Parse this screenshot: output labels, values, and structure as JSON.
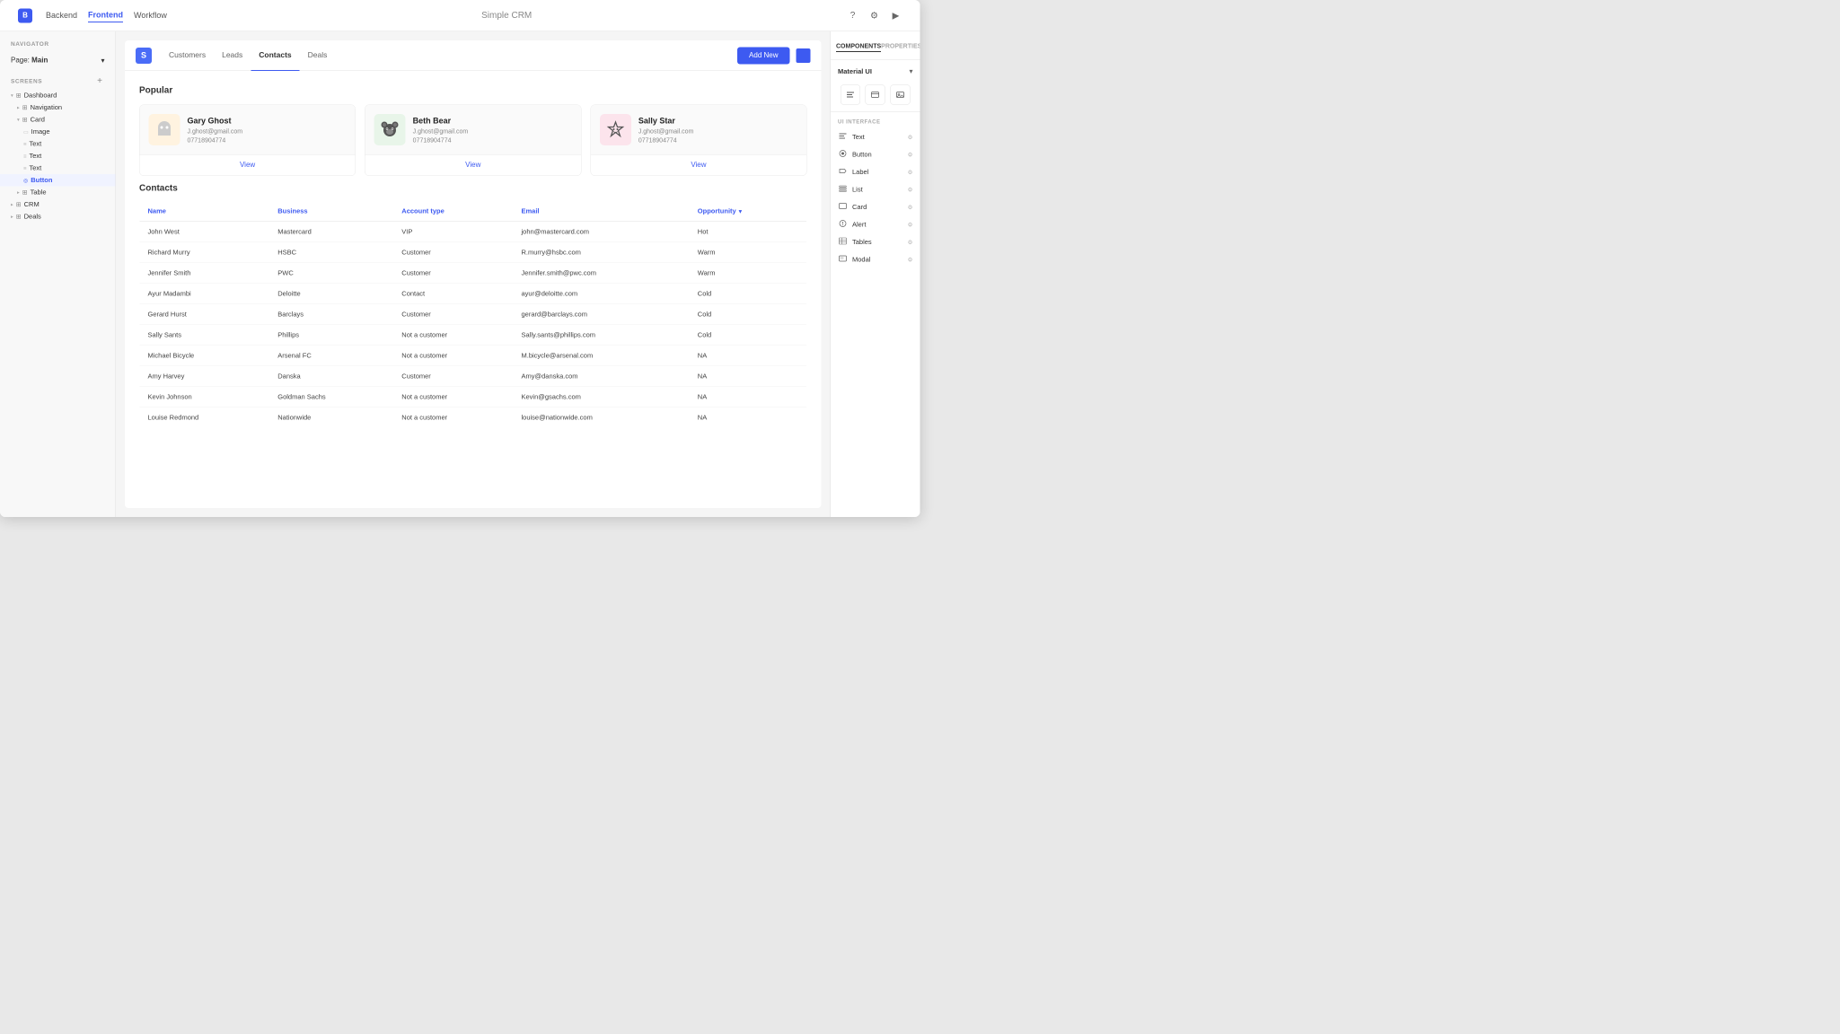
{
  "topbar": {
    "logo": "B",
    "nav_items": [
      "Backend",
      "Frontend",
      "Workflow"
    ],
    "active_nav": "Frontend",
    "title": "Simple CRM"
  },
  "sidebar": {
    "navigator_label": "NAVIGATOR",
    "page_label": "Page:",
    "page_name": "Main",
    "screens_label": "SCREENS",
    "add_label": "+",
    "tree": [
      {
        "label": "Dashboard",
        "level": 0,
        "type": "screen",
        "expanded": true
      },
      {
        "label": "Navigation",
        "level": 1,
        "type": "component"
      },
      {
        "label": "Card",
        "level": 1,
        "type": "component",
        "expanded": true
      },
      {
        "label": "Image",
        "level": 2,
        "type": "image"
      },
      {
        "label": "Text",
        "level": 2,
        "type": "text"
      },
      {
        "label": "Text",
        "level": 2,
        "type": "text"
      },
      {
        "label": "Text",
        "level": 2,
        "type": "text"
      },
      {
        "label": "Button",
        "level": 2,
        "type": "button",
        "selected": true
      },
      {
        "label": "Table",
        "level": 1,
        "type": "table"
      },
      {
        "label": "CRM",
        "level": 0,
        "type": "screen"
      },
      {
        "label": "Deals",
        "level": 0,
        "type": "screen"
      }
    ]
  },
  "content": {
    "tab_logo": "S",
    "tabs": [
      "Customers",
      "Leads",
      "Contacts",
      "Deals"
    ],
    "active_tab": "Contacts",
    "add_button_label": "Add New",
    "popular_title": "Popular",
    "contacts_title": "Contacts",
    "cards": [
      {
        "name": "Gary Ghost",
        "email": "J.ghost@gmail.com",
        "phone": "07718904774",
        "view_label": "View",
        "emoji": "👻",
        "bg": "ghost"
      },
      {
        "name": "Beth Bear",
        "email": "J.ghost@gmail.com",
        "phone": "07718904774",
        "view_label": "View",
        "emoji": "🐻",
        "bg": "bear"
      },
      {
        "name": "Sally Star",
        "email": "J.ghost@gmail.com",
        "phone": "07718904774",
        "view_label": "View",
        "emoji": "⭐",
        "bg": "star"
      }
    ],
    "table_headers": [
      "Name",
      "Business",
      "Account type",
      "Email",
      "Opportunity"
    ],
    "table_rows": [
      {
        "name": "John West",
        "business": "Mastercard",
        "account_type": "VIP",
        "email": "john@mastercard.com",
        "opportunity": "Hot"
      },
      {
        "name": "Richard Murry",
        "business": "HSBC",
        "account_type": "Customer",
        "email": "R.murry@hsbc.com",
        "opportunity": "Warm"
      },
      {
        "name": "Jennifer Smith",
        "business": "PWC",
        "account_type": "Customer",
        "email": "Jennifer.smith@pwc.com",
        "opportunity": "Warm"
      },
      {
        "name": "Ayur Madambi",
        "business": "Deloitte",
        "account_type": "Contact",
        "email": "ayur@deloitte.com",
        "opportunity": "Cold"
      },
      {
        "name": "Gerard Hurst",
        "business": "Barclays",
        "account_type": "Customer",
        "email": "gerard@barclays.com",
        "opportunity": "Cold"
      },
      {
        "name": "Sally Sants",
        "business": "Phillips",
        "account_type": "Not a customer",
        "email": "Sally.sants@phillips.com",
        "opportunity": "Cold"
      },
      {
        "name": "Michael Bicycle",
        "business": "Arsenal FC",
        "account_type": "Not a customer",
        "email": "M.bicycle@arsenal.com",
        "opportunity": "NA"
      },
      {
        "name": "Amy Harvey",
        "business": "Danska",
        "account_type": "Customer",
        "email": "Amy@danska.com",
        "opportunity": "NA"
      },
      {
        "name": "Kevin Johnson",
        "business": "Goldman Sachs",
        "account_type": "Not a customer",
        "email": "Kevin@gsachs.com",
        "opportunity": "NA"
      },
      {
        "name": "Louise Redmond",
        "business": "Nationwide",
        "account_type": "Not a customer",
        "email": "louise@nationwide.com",
        "opportunity": "NA"
      }
    ]
  },
  "right_panel": {
    "tabs": [
      "COMPONENTS",
      "PROPERTIES"
    ],
    "active_tab": "COMPONENTS",
    "material_ui_label": "Material UI",
    "ui_interface_label": "UI INTERFACE",
    "ui_items": [
      {
        "label": "Text",
        "icon": "≡"
      },
      {
        "label": "Button",
        "icon": "◎"
      },
      {
        "label": "Label",
        "icon": "◇"
      },
      {
        "label": "List",
        "icon": "☰"
      },
      {
        "label": "Card",
        "icon": "▭"
      },
      {
        "label": "Alert",
        "icon": "⊙"
      },
      {
        "label": "Tables",
        "icon": "⊞"
      },
      {
        "label": "Modal",
        "icon": "▭"
      }
    ]
  }
}
